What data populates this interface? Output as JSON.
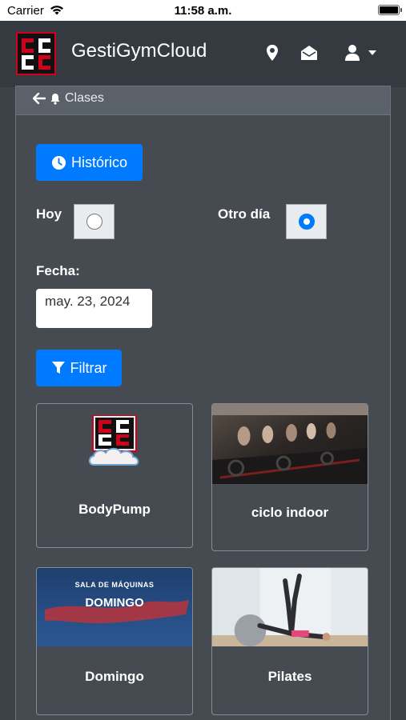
{
  "status_bar": {
    "carrier": "Carrier",
    "time": "11:58 a.m."
  },
  "header": {
    "app_title": "GestiGymCloud",
    "icons": [
      "location-pin-icon",
      "mail-open-icon",
      "user-icon",
      "caret-down-icon"
    ]
  },
  "breadcrumb": {
    "label": "Clases"
  },
  "history_button": {
    "label": "Histórico"
  },
  "filters": {
    "today_label": "Hoy",
    "other_day_label": "Otro día",
    "selected": "Otro día",
    "date_label": "Fecha:",
    "date_value": "may. 23, 2024"
  },
  "filter_button": {
    "label": "Filtrar"
  },
  "classes": [
    {
      "name": "BodyPump"
    },
    {
      "name": "ciclo indoor"
    },
    {
      "name": "Domingo",
      "banner_line1": "SALA DE MÁQUINAS",
      "banner_line2": "DOMINGO"
    },
    {
      "name": "Pilates"
    }
  ],
  "colors": {
    "primary": "#007bff",
    "navbar": "#343a40",
    "background": "#3d4247",
    "brand_red": "#d0021b"
  }
}
